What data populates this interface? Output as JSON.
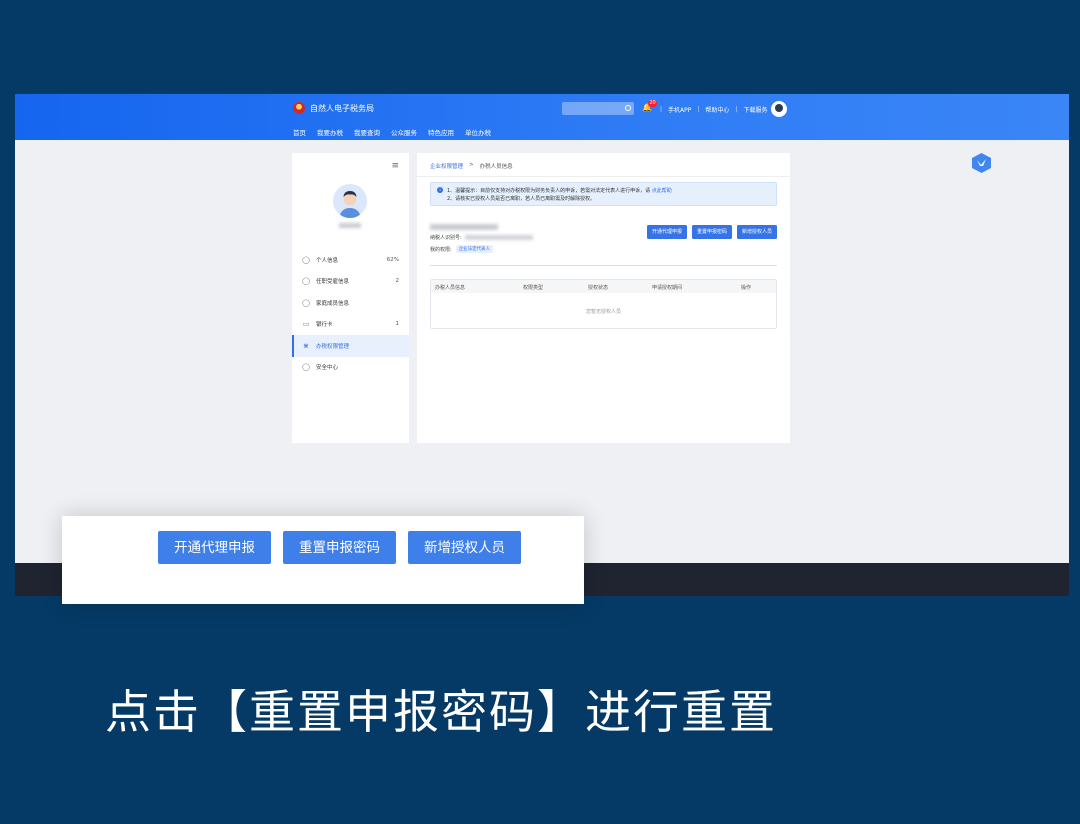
{
  "header": {
    "site_title": "自然人电子税务局",
    "nav": [
      "首页",
      "我要办税",
      "我要查询",
      "公众服务",
      "特色应用",
      "单位办税"
    ],
    "notification_count": "20",
    "links": [
      "手机APP",
      "帮助中心",
      "下载服务"
    ],
    "separator": "|"
  },
  "sidebar": {
    "menu_icon": "≡",
    "items": [
      {
        "label": "个人信息",
        "count": "62%",
        "icon": "user-icon"
      },
      {
        "label": "任职受雇信息",
        "count": "2",
        "icon": "user-plus-icon"
      },
      {
        "label": "家庭成员信息",
        "count": "",
        "icon": "user-icon"
      },
      {
        "label": "银行卡",
        "count": "1",
        "icon": "card-icon"
      },
      {
        "label": "办税权限管理",
        "count": "",
        "icon": "network-icon"
      },
      {
        "label": "安全中心",
        "count": "",
        "icon": "shield-icon"
      }
    ],
    "active_index": 4
  },
  "main": {
    "breadcrumb": {
      "parent": "企业权限管理",
      "separator": ">",
      "current": "办税人员信息"
    },
    "notice": {
      "line1_prefix": "1、温馨提示：目前仅支持对办税权限为财务负责人的申诉，若需对法定代表人进行申诉，请",
      "line1_link": "点此帮助",
      "line2": "2、请核实已授权人员是否已离职，若人员已离职需及时解除授权。"
    },
    "taxid_label": "纳税人识别号:",
    "perm_label": "我的权限:",
    "perm_tag": "企业法定代表人",
    "buttons": [
      "开通代理申报",
      "重置申报密码",
      "新增授权人员"
    ],
    "table": {
      "columns": [
        "办税人员信息",
        "权限类型",
        "授权状态",
        "申请授权期间",
        "操作"
      ],
      "empty_text": "您暂无授权人员"
    }
  },
  "zoom": {
    "buttons": [
      "开通代理申报",
      "重置申报密码",
      "新增授权人员"
    ]
  },
  "caption": "点击【重置申报密码】进行重置",
  "colors": {
    "page_bg": "#053a66",
    "topbar": "#2f7cf5",
    "primary_button": "#3573e6",
    "link": "#2f6fe8"
  }
}
